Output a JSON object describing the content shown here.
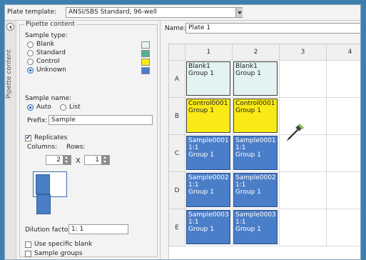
{
  "template": {
    "label": "Plate template:",
    "value": "ANSI/SBS Standard, 96-well"
  },
  "side_tab": {
    "label": "Pipette content"
  },
  "pipette_content": {
    "title": "Pipette content",
    "sample_type": {
      "label": "Sample type:",
      "options": [
        {
          "label": "Blank",
          "color": "#e3f2f3",
          "selected": false
        },
        {
          "label": "Standard",
          "color": "#55b08a",
          "selected": false
        },
        {
          "label": "Control",
          "color": "#f9ea16",
          "selected": false
        },
        {
          "label": "Unknown",
          "color": "#4b7ec8",
          "selected": true
        }
      ]
    },
    "sample_name": {
      "label": "Sample name:",
      "auto_label": "Auto",
      "list_label": "List",
      "selected": "Auto",
      "prefix_label": "Prefix:",
      "prefix_value": "Sample"
    },
    "replicates": {
      "label": "Replicates",
      "checked": true,
      "columns_label": "Columns:",
      "rows_label": "Rows:",
      "columns_value": "2",
      "x_label": "X",
      "rows_value": "1"
    },
    "dilution": {
      "label": "Dilution factor:",
      "value": "1: 1"
    },
    "use_specific_blank": {
      "label": "Use specific blank",
      "checked": false
    },
    "sample_groups": {
      "label": "Sample groups",
      "checked": false
    }
  },
  "plate": {
    "name_label": "Name:",
    "name_value": "Plate 1",
    "columns": [
      "1",
      "2",
      "3",
      "4"
    ],
    "rows": [
      "A",
      "B",
      "C",
      "D",
      "E"
    ],
    "wells": [
      [
        {
          "type": "blank",
          "lines": [
            "Blank1",
            "Group 1"
          ]
        },
        {
          "type": "blank",
          "lines": [
            "Blank1",
            "Group 1"
          ]
        },
        null,
        null
      ],
      [
        {
          "type": "control",
          "lines": [
            "Control0001",
            "Group 1"
          ]
        },
        {
          "type": "control",
          "lines": [
            "Control0001",
            "Group 1"
          ]
        },
        null,
        null
      ],
      [
        {
          "type": "unknown",
          "lines": [
            "Sample0001",
            "1:1",
            "Group 1"
          ]
        },
        {
          "type": "unknown",
          "lines": [
            "Sample0001",
            "1:1",
            "Group 1"
          ]
        },
        null,
        null
      ],
      [
        {
          "type": "unknown",
          "lines": [
            "Sample0002",
            "1:1",
            "Group 1"
          ]
        },
        {
          "type": "unknown",
          "lines": [
            "Sample0002",
            "1:1",
            "Group 1"
          ]
        },
        null,
        null
      ],
      [
        {
          "type": "unknown",
          "lines": [
            "Sample0003",
            "1:1",
            "Group 1"
          ]
        },
        {
          "type": "unknown",
          "lines": [
            "Sample0003",
            "1:1",
            "Group 1"
          ]
        },
        null,
        null
      ]
    ],
    "cursor_icon": "pipette-icon"
  }
}
